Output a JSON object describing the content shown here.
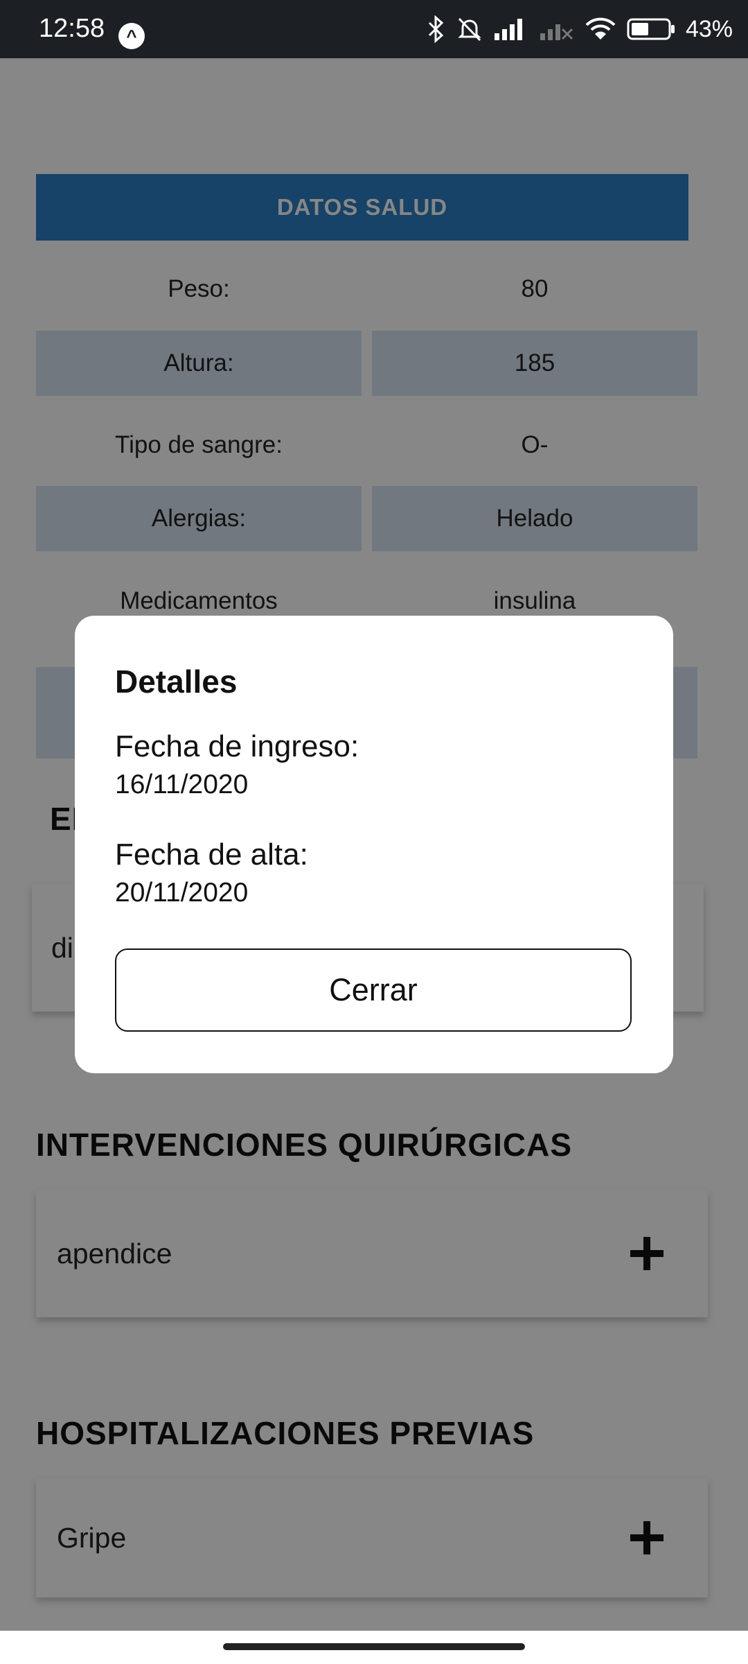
{
  "status_bar": {
    "time": "12:58",
    "app_icon_letter": "^",
    "battery_pct": "43%"
  },
  "health": {
    "header": "DATOS SALUD",
    "rows": [
      {
        "label": "Peso:",
        "value": "80"
      },
      {
        "label": "Altura:",
        "value": "185"
      },
      {
        "label": "Tipo de sangre:",
        "value": "O-"
      },
      {
        "label": "Alergias:",
        "value": "Helado"
      },
      {
        "label": "Medicamentos",
        "value": "insulina"
      }
    ]
  },
  "sections": {
    "enfermedades": {
      "title_visible": "EI",
      "item": "di"
    },
    "intervenciones": {
      "title": "INTERVENCIONES QUIRÚRGICAS",
      "item": "apendice"
    },
    "hospitalizaciones": {
      "title": "HOSPITALIZACIONES PREVIAS",
      "item": "Gripe"
    }
  },
  "dialog": {
    "title": "Detalles",
    "ingreso_label": "Fecha de ingreso:",
    "ingreso_value": "16/11/2020",
    "alta_label": "Fecha de alta:",
    "alta_value": "20/11/2020",
    "close_label": "Cerrar"
  },
  "colors": {
    "header_blue": "#2b7fc2",
    "row_shade": "#d5e3f1",
    "status_bar": "#1c1f24"
  },
  "icons": {
    "status_bar": [
      "bluetooth-icon",
      "bell-off-icon",
      "signal-icon",
      "signal-no-service-icon",
      "wifi-icon",
      "battery-icon"
    ],
    "card_action": "plus-icon"
  }
}
